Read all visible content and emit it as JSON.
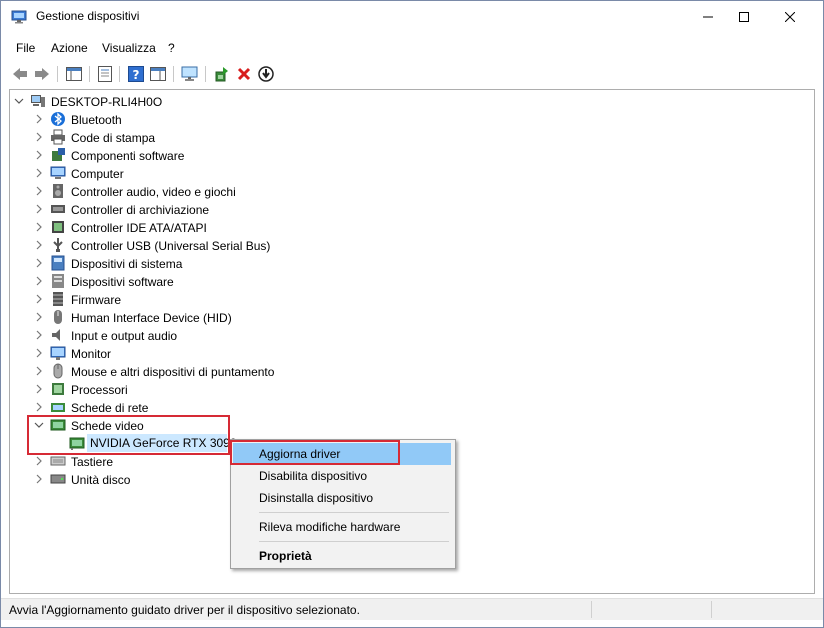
{
  "window": {
    "title": "Gestione dispositivi",
    "min_glyph": "—",
    "max_glyph": "☐",
    "close_glyph": "✕"
  },
  "menu": [
    "File",
    "Azione",
    "Visualizza",
    "?"
  ],
  "tree": {
    "root": "DESKTOP-RLI4H0O",
    "categories": [
      {
        "label": "Bluetooth",
        "icon": "bluetooth-icon"
      },
      {
        "label": "Code di stampa",
        "icon": "printer-icon"
      },
      {
        "label": "Componenti software",
        "icon": "software-component-icon"
      },
      {
        "label": "Computer",
        "icon": "computer-icon"
      },
      {
        "label": "Controller audio, video e giochi",
        "icon": "speaker-icon"
      },
      {
        "label": "Controller di archiviazione",
        "icon": "storage-controller-icon"
      },
      {
        "label": "Controller IDE ATA/ATAPI",
        "icon": "ide-controller-icon"
      },
      {
        "label": "Controller USB (Universal Serial Bus)",
        "icon": "usb-icon"
      },
      {
        "label": "Dispositivi di sistema",
        "icon": "system-device-icon"
      },
      {
        "label": "Dispositivi software",
        "icon": "software-device-icon"
      },
      {
        "label": "Firmware",
        "icon": "firmware-icon"
      },
      {
        "label": "Human Interface Device (HID)",
        "icon": "hid-icon"
      },
      {
        "label": "Input e output audio",
        "icon": "audio-io-icon"
      },
      {
        "label": "Monitor",
        "icon": "monitor-icon"
      },
      {
        "label": "Mouse e altri dispositivi di puntamento",
        "icon": "mouse-icon"
      },
      {
        "label": "Processori",
        "icon": "processor-icon"
      },
      {
        "label": "Schede di rete",
        "icon": "network-adapter-icon"
      },
      {
        "label": "Schede video",
        "icon": "display-adapter-icon",
        "expanded": true
      },
      {
        "label": "Tastiere",
        "icon": "keyboard-icon"
      },
      {
        "label": "Unità disco",
        "icon": "disk-drive-icon"
      }
    ],
    "selected_child": "NVIDIA GeForce RTX 3090"
  },
  "context_menu": {
    "items": [
      "Aggiorna driver",
      "Disabilita dispositivo",
      "Disinstalla dispositivo",
      "Rileva modifiche hardware",
      "Proprietà"
    ],
    "highlighted": "Aggiorna driver"
  },
  "status": "Avvia l'Aggiornamento guidato driver per il dispositivo selezionato.",
  "colors": {
    "highlight_box": "#d62a35",
    "menu_hover": "#91c9f7",
    "selection": "#cce8ff"
  }
}
